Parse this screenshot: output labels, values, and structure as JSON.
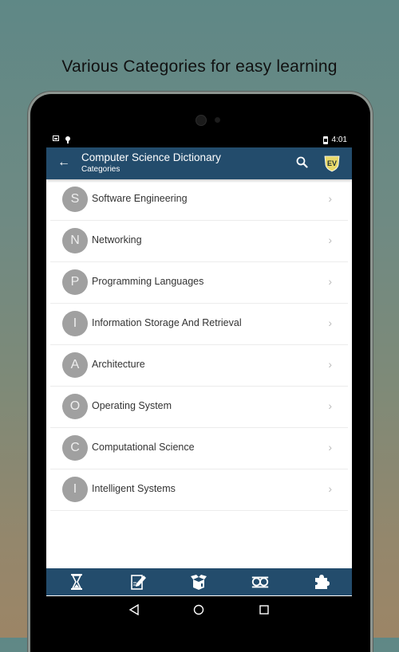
{
  "promo_text": "Various Categories for easy learning",
  "status_bar": {
    "time": "4:01"
  },
  "app_bar": {
    "title": "Computer Science Dictionary",
    "subtitle": "Categories",
    "back_icon": "arrow-left",
    "search_icon": "search",
    "logo_text": "EV"
  },
  "categories": [
    {
      "initial": "S",
      "label": "Software Engineering"
    },
    {
      "initial": "N",
      "label": "Networking"
    },
    {
      "initial": "P",
      "label": "Programming Languages"
    },
    {
      "initial": "I",
      "label": "Information Storage And Retrieval"
    },
    {
      "initial": "A",
      "label": "Architecture"
    },
    {
      "initial": "O",
      "label": "Operating System"
    },
    {
      "initial": "C",
      "label": "Computational Science"
    },
    {
      "initial": "I",
      "label": "Intelligent Systems"
    }
  ],
  "bottom_nav": [
    "hourglass",
    "edit-document",
    "open-box",
    "owl",
    "puzzle-piece"
  ],
  "system_nav": [
    "back",
    "home",
    "recents"
  ],
  "colors": {
    "primary": "#234c6c",
    "avatar": "#a0a0a0"
  },
  "chevron": "›"
}
